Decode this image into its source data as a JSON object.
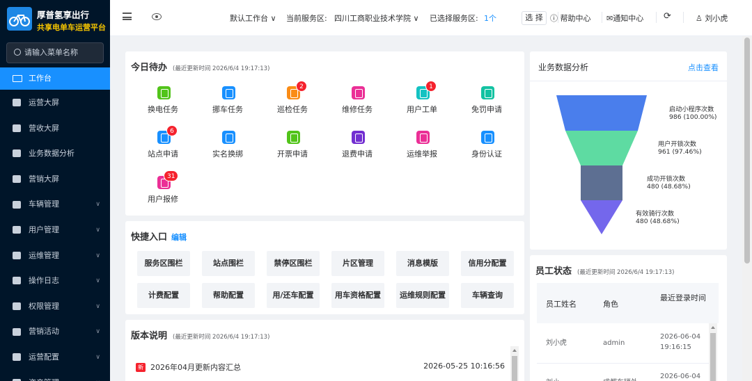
{
  "brand": {
    "title": "厚普氢享出行",
    "subtitle": "共享电单车运营平台",
    "logo_icon": "bike-logo-icon"
  },
  "search": {
    "placeholder": "请输入菜单名称"
  },
  "menu": [
    {
      "label": "工作台",
      "icon": "monitor-icon",
      "active": true
    },
    {
      "label": "运营大屏",
      "icon": "chart-icon"
    },
    {
      "label": "营收大屏",
      "icon": "money-bag-icon"
    },
    {
      "label": "业务数据分析",
      "icon": "analysis-icon"
    },
    {
      "label": "营销大屏",
      "icon": "bar-chart-icon"
    },
    {
      "label": "车辆管理",
      "icon": "bike-icon",
      "expandable": true
    },
    {
      "label": "用户管理",
      "icon": "user-icon",
      "expandable": true
    },
    {
      "label": "运维管理",
      "icon": "wrench-icon",
      "expandable": true
    },
    {
      "label": "操作日志",
      "icon": "log-icon",
      "expandable": true
    },
    {
      "label": "权限管理",
      "icon": "shield-icon",
      "expandable": true
    },
    {
      "label": "营销活动",
      "icon": "gift-icon",
      "expandable": true
    },
    {
      "label": "运营配置",
      "icon": "config-icon",
      "expandable": true
    },
    {
      "label": "资产管理",
      "icon": "asset-icon",
      "expandable": true
    }
  ],
  "topbar": {
    "workspace": "默认工作台 ∨",
    "service_label": "当前服务区:",
    "service_value": "四川工商职业技术学院 ∨",
    "selected_label": "已选择服务区:",
    "selected_count": "1个",
    "select_btn": "选 择",
    "help": "帮助中心",
    "notify": "通知中心",
    "user": "刘小虎"
  },
  "todo": {
    "title": "今日待办",
    "updated": "(最近更新时间 2026/6/4 19:17:13)",
    "items": [
      {
        "label": "换电任务",
        "color": "#52c41a"
      },
      {
        "label": "挪车任务",
        "color": "#1890ff"
      },
      {
        "label": "巡检任务",
        "color": "#fa8c16",
        "badge": "2"
      },
      {
        "label": "维修任务",
        "color": "#eb2f96"
      },
      {
        "label": "用户工单",
        "color": "#13c2c2",
        "badge": "1"
      },
      {
        "label": "免罚申请",
        "color": "#13c2a2"
      },
      {
        "label": "站点申请",
        "color": "#1890ff",
        "badge": "6"
      },
      {
        "label": "实名换绑",
        "color": "#1890ff"
      },
      {
        "label": "开票申请",
        "color": "#52c41a"
      },
      {
        "label": "退费申请",
        "color": "#722ed1"
      },
      {
        "label": "运维举报",
        "color": "#eb2f96"
      },
      {
        "label": "身份认证",
        "color": "#1890ff"
      },
      {
        "label": "用户报修",
        "color": "#eb2f96",
        "badge": "31"
      }
    ]
  },
  "quick": {
    "title": "快捷入口",
    "edit": "编辑",
    "items": [
      "服务区围栏",
      "站点围栏",
      "禁停区围栏",
      "片区管理",
      "消息模版",
      "信用分配置",
      "计费配置",
      "帮助配置",
      "用/还车配置",
      "用车资格配置",
      "运维规则配置",
      "车辆查询"
    ]
  },
  "version": {
    "title": "版本说明",
    "updated": "(最近更新时间 2026/6/4 19:17:13)",
    "items": [
      {
        "tag": "新",
        "text": "2026年04月更新内容汇总",
        "date": "2026-05-25 10:16:56"
      }
    ]
  },
  "analysis": {
    "title": "业务数据分析",
    "link": "点击查看",
    "funnel": [
      {
        "name": "启动小程序次数",
        "value": "986 (100.00%)",
        "color": "#4a7eec"
      },
      {
        "name": "用户开锁次数",
        "value": "961 (97.46%)",
        "color": "#5edba2"
      },
      {
        "name": "成功开锁次数",
        "value": "480 (48.68%)",
        "color": "#5d6f92"
      },
      {
        "name": "有效骑行次数",
        "value": "480 (48.68%)",
        "color": "#7467ec"
      }
    ]
  },
  "staff": {
    "title": "员工状态",
    "updated": "(最近更新时间 2026/6/4 19:17:13)",
    "headers": [
      "员工姓名",
      "角色",
      "最近登录时间"
    ],
    "rows": [
      {
        "name": "刘小虎",
        "role": "admin",
        "time": "2026-06-04 19:16:15"
      },
      {
        "name": "刘小",
        "role": "成都车辆外",
        "time": "2026-06-04"
      }
    ]
  }
}
